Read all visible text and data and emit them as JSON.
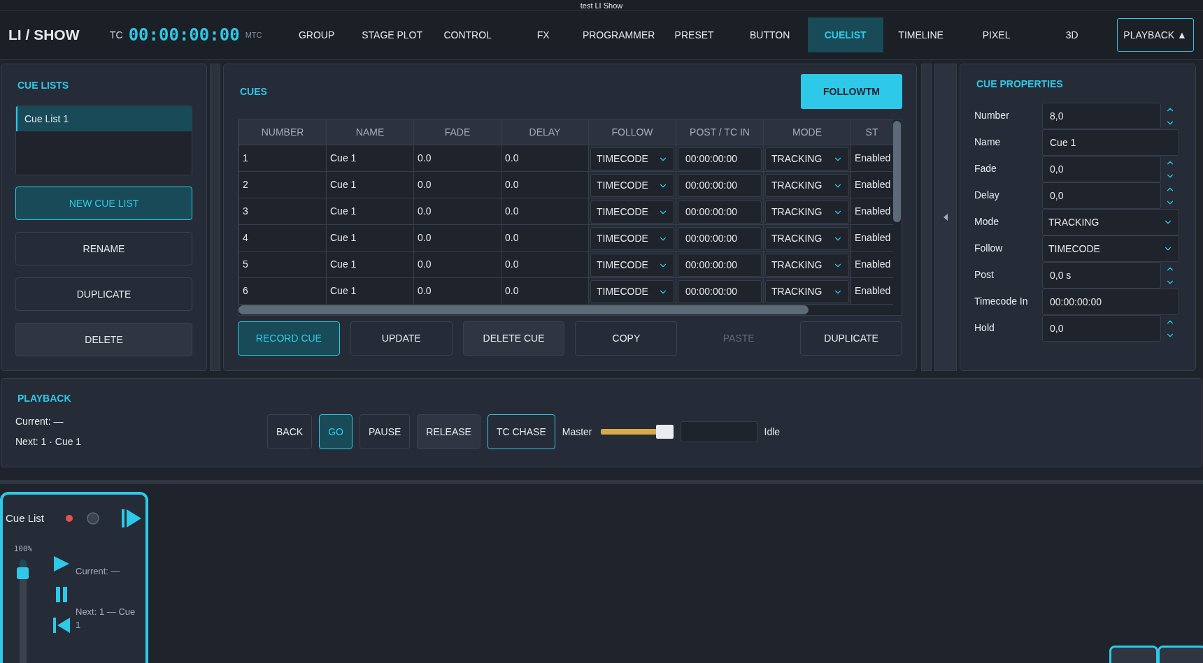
{
  "window": {
    "title": "test LI Show"
  },
  "nav": {
    "logo": "LI / SHOW",
    "tc_label": "TC",
    "timecode": "00:00:00:00",
    "tc_source": "MTC",
    "toggle": "PLAYBACK ▲",
    "tabs": [
      {
        "label": "GROUP",
        "selected": false
      },
      {
        "label": "STAGE PLOT",
        "selected": false
      },
      {
        "label": "CONTROL",
        "selected": false
      },
      {
        "label": "FX",
        "selected": false
      },
      {
        "label": "PROGRAMMER",
        "selected": false
      },
      {
        "label": "PRESET",
        "selected": false
      },
      {
        "label": "BUTTON",
        "selected": false
      },
      {
        "label": "CUELIST",
        "selected": true
      },
      {
        "label": "TIMELINE",
        "selected": false
      },
      {
        "label": "PIXEL",
        "selected": false
      },
      {
        "label": "3D",
        "selected": false
      }
    ]
  },
  "cue_lists": {
    "title": "CUE LISTS",
    "items": [
      {
        "label": "Cue List 1",
        "selected": true
      }
    ],
    "buttons": [
      {
        "label": "NEW CUE LIST",
        "kind": "primary"
      },
      {
        "label": "RENAME",
        "kind": "default"
      },
      {
        "label": "DUPLICATE",
        "kind": "default"
      },
      {
        "label": "DELETE",
        "kind": "secondary"
      }
    ]
  },
  "cues": {
    "title": "CUES",
    "follow_button": "FOLLOWTM",
    "table": {
      "columns": [
        {
          "label": "NUMBER",
          "kind": "text"
        },
        {
          "label": "NAME",
          "kind": "text"
        },
        {
          "label": "FADE",
          "kind": "text"
        },
        {
          "label": "DELAY",
          "kind": "text"
        },
        {
          "label": "FOLLOW",
          "kind": "select"
        },
        {
          "label": "POST / TC IN",
          "kind": "input"
        },
        {
          "label": "MODE",
          "kind": "select"
        },
        {
          "label": "ST",
          "kind": "text"
        }
      ],
      "rows": [
        [
          "1",
          "Cue 1",
          "0.0",
          "0.0",
          "TIMECODE",
          "00:00:00:00",
          "TRACKING",
          "Enabled"
        ],
        [
          "2",
          "Cue 1",
          "0.0",
          "0.0",
          "TIMECODE",
          "00:00:00:00",
          "TRACKING",
          "Enabled"
        ],
        [
          "3",
          "Cue 1",
          "0.0",
          "0.0",
          "TIMECODE",
          "00:00:00:00",
          "TRACKING",
          "Enabled"
        ],
        [
          "4",
          "Cue 1",
          "0.0",
          "0.0",
          "TIMECODE",
          "00:00:00:00",
          "TRACKING",
          "Enabled"
        ],
        [
          "5",
          "Cue 1",
          "0.0",
          "0.0",
          "TIMECODE",
          "00:00:00:00",
          "TRACKING",
          "Enabled"
        ],
        [
          "6",
          "Cue 1",
          "0.0",
          "0.0",
          "TIMECODE",
          "00:00:00:00",
          "TRACKING",
          "Enabled"
        ]
      ]
    },
    "buttons": [
      {
        "label": "RECORD CUE",
        "kind": "primary"
      },
      {
        "label": "UPDATE",
        "kind": "default"
      },
      {
        "label": "DELETE CUE",
        "kind": "secondary"
      },
      {
        "label": "COPY",
        "kind": "default"
      },
      {
        "label": "PASTE",
        "kind": "disabled"
      },
      {
        "label": "DUPLICATE",
        "kind": "default"
      }
    ]
  },
  "cue_properties": {
    "title": "CUE PROPERTIES",
    "fields": [
      {
        "label": "Number",
        "kind": "spin",
        "value": "8,0"
      },
      {
        "label": "Name",
        "kind": "text",
        "value": "Cue 1"
      },
      {
        "label": "Fade",
        "kind": "spin",
        "value": "0,0"
      },
      {
        "label": "Delay",
        "kind": "spin",
        "value": "0,0"
      },
      {
        "label": "Mode",
        "kind": "select",
        "value": "TRACKING"
      },
      {
        "label": "Follow",
        "kind": "select",
        "value": "TIMECODE"
      },
      {
        "label": "Post",
        "kind": "spin",
        "value": "0,0 s"
      },
      {
        "label": "Timecode In",
        "kind": "text",
        "value": "00:00:00:00"
      },
      {
        "label": "Hold",
        "kind": "spin",
        "value": "0,0"
      }
    ]
  },
  "playback": {
    "title": "PLAYBACK",
    "current": "Current: —",
    "next": "Next: 1 · Cue 1",
    "buttons": [
      {
        "label": "BACK",
        "kind": "default"
      },
      {
        "label": "GO",
        "kind": "active"
      },
      {
        "label": "PAUSE",
        "kind": "default"
      },
      {
        "label": "RELEASE",
        "kind": "secondary"
      },
      {
        "label": "TC CHASE",
        "kind": "outline"
      }
    ],
    "master_label": "Master",
    "master": {
      "level": 0.9
    },
    "status": "Idle"
  },
  "widget": {
    "title": "Cue List",
    "level_label": "100%",
    "fader": {
      "level": 1
    },
    "current": "Current: —",
    "next": "Next: 1 — Cue 1"
  }
}
